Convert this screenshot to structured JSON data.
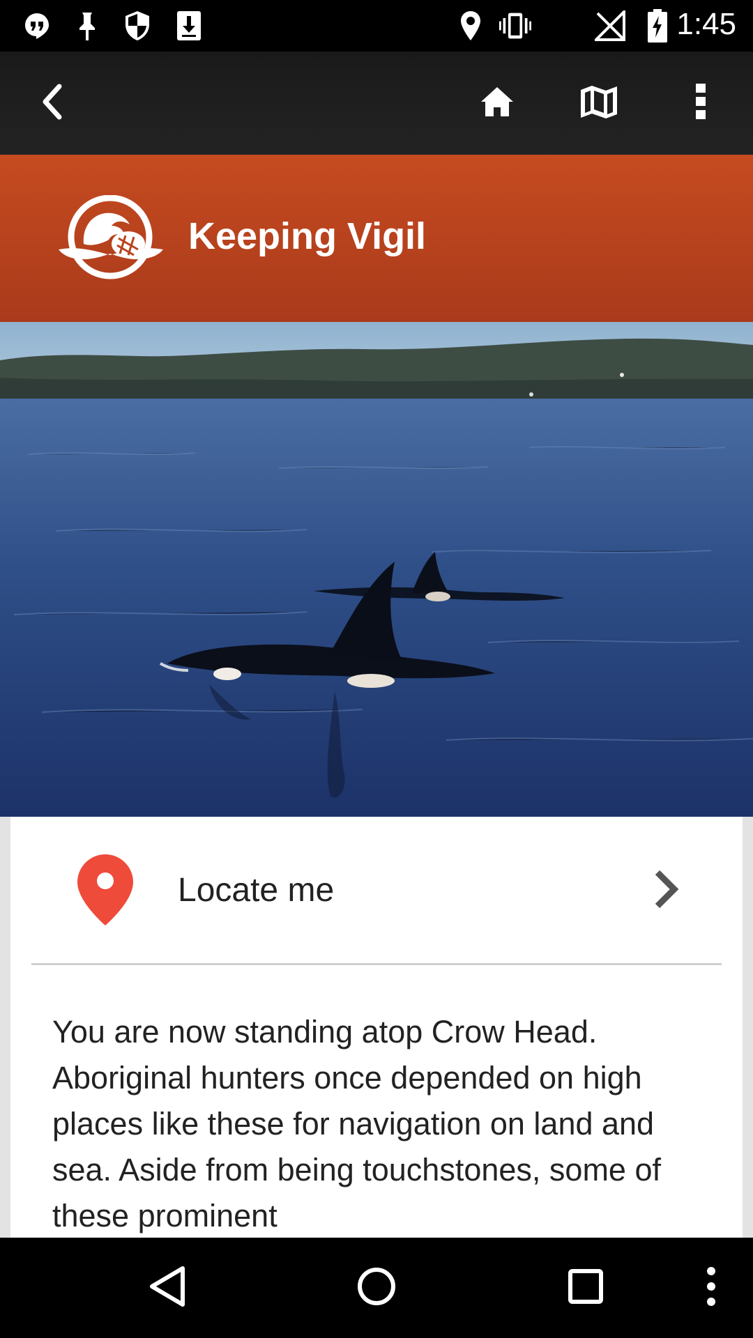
{
  "status_bar": {
    "time": "1:45",
    "left_icons": [
      "hangouts-icon",
      "pin-icon",
      "shield-icon",
      "download-icon"
    ],
    "right_icons": [
      "location-icon",
      "vibrate-icon",
      "no-signal-icon",
      "battery-charging-icon"
    ]
  },
  "app_bar": {
    "buttons": [
      "back-icon",
      "home-icon",
      "map-icon",
      "overflow-menu-icon"
    ]
  },
  "banner": {
    "title": "Keeping Vigil",
    "color": "#c0461f"
  },
  "locate": {
    "label": "Locate me",
    "pin_color": "#ee4b3b"
  },
  "body": {
    "text": "You are now standing atop Crow Head. Aboriginal hunters once depended on high places like these for navigation on land and sea. Aside from being touchstones, some of these prominent"
  },
  "nav_bar": {
    "buttons": [
      "back-triangle-icon",
      "home-circle-icon",
      "recents-square-icon",
      "more-dots-icon"
    ]
  }
}
